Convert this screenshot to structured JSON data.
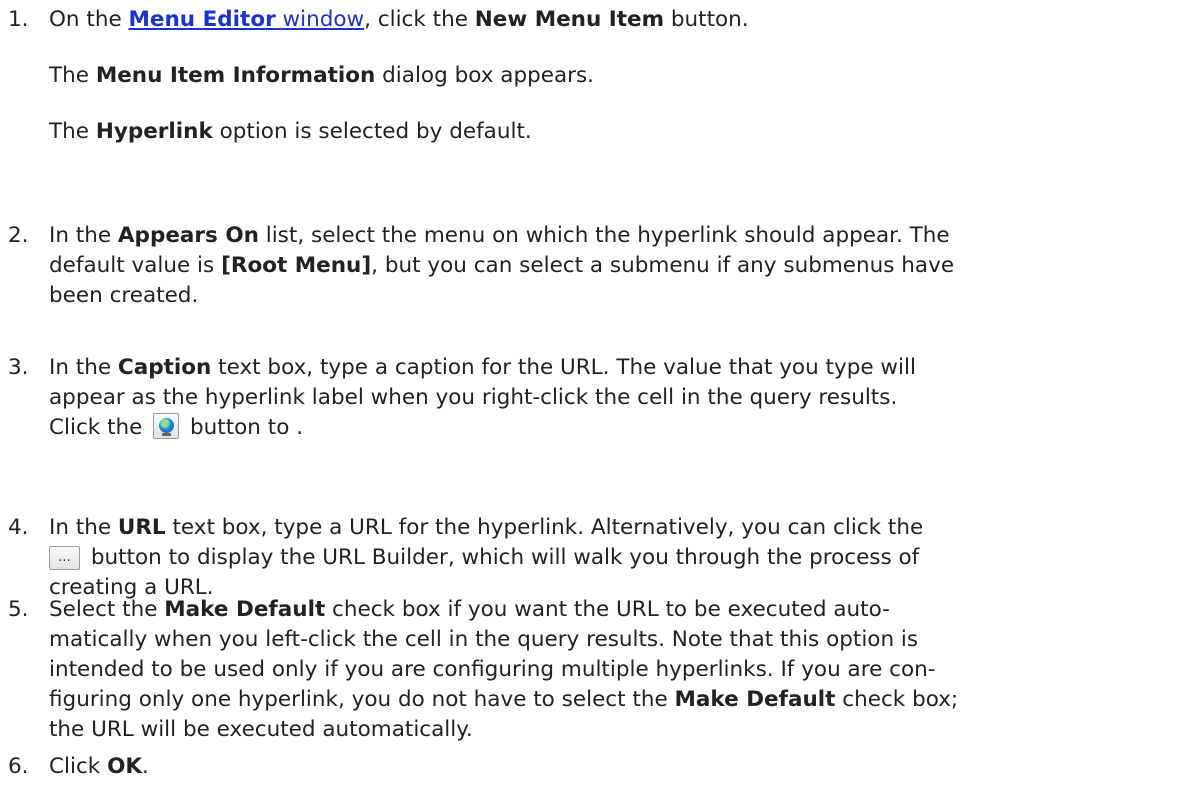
{
  "steps": [
    {
      "num": "1.",
      "t1": "On the ",
      "link_bold": "Menu Editor",
      "link_rest": " window",
      "t2": ", click the ",
      "b1": "New Menu Item",
      "t3": " button.",
      "p2_t1": "The ",
      "p2_b1": "Menu Item Information",
      "p2_t2": " dialog box appears.",
      "p3_t1": "The ",
      "p3_b1": "Hyperlink",
      "p3_t2": " option is selected by default."
    },
    {
      "num": "2.",
      "t1": "In the ",
      "b1": "Appears On",
      "t2": " list, select the menu on which the hyperlink should appear. The",
      "t3": "default value is ",
      "b2": "[Root Menu]",
      "t4": ", but you can select a submenu if any submenus have",
      "t5": "been created."
    },
    {
      "num": "3.",
      "t1": "In the ",
      "b1": "Caption",
      "t2": " text box, type a caption for the URL. The value that you type will",
      "t3": "appear as the hyperlink label when you right-click the cell in the query results.",
      "t4": "Click the ",
      "t5": " button to ."
    },
    {
      "num": "4.",
      "t1": "In the ",
      "b1": "URL",
      "t2": " text box, type a URL for the hyperlink. Alternatively, you can click the",
      "btn_text": "...",
      "t3": " button to display the URL Builder, which will walk you through the process of",
      "t4": "creating a URL."
    },
    {
      "num": "5.",
      "t1": "Select the ",
      "b1": "Make Default",
      "t2": " check box if you want the URL to be executed auto-",
      "t3": "matically when you left-click the cell in the query results. Note that this option is",
      "t4": "intended to be used only if you are configuring multiple hyperlinks. If you are con-",
      "t5": "figuring only one hyperlink, you do not have to select the ",
      "b2": "Make Default",
      "t6": " check box;",
      "t7": "the URL will be executed automatically."
    },
    {
      "num": "6.",
      "t1": "Click ",
      "b1": "OK",
      "t2": "."
    }
  ],
  "icons": {
    "globe_button": "globe-icon",
    "browse_button": "ellipsis-icon"
  },
  "colors": {
    "link": "#1a33c9",
    "text": "#222222"
  }
}
